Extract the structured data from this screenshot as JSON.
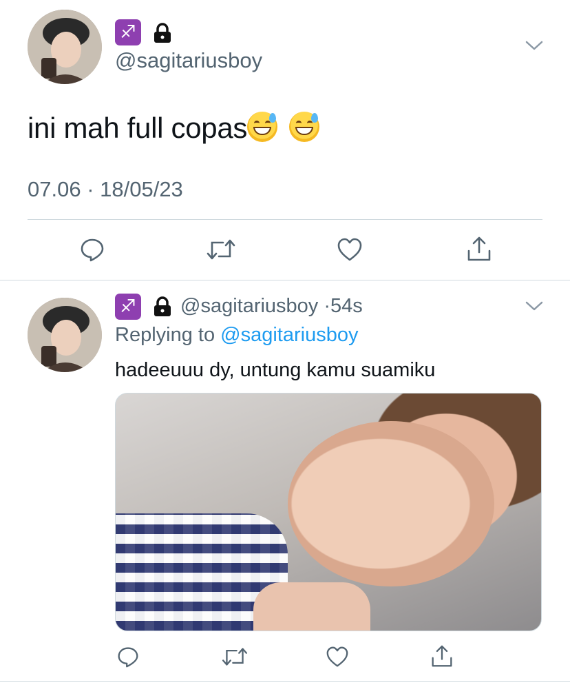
{
  "tweet_main": {
    "zodiac_symbol": "♐",
    "handle": "@sagitariusboy",
    "text": "ini mah full copas",
    "emoji": [
      "grinning-sweat-emoji",
      "grinning-sweat-emoji"
    ],
    "timestamp": "07.06 · 18/05/23"
  },
  "tweet_reply": {
    "zodiac_symbol": "♐",
    "handle": "@sagitariusboy",
    "separator": "·",
    "age": "54s",
    "replying_prefix": "Replying to",
    "replying_handle": "@sagitariusboy",
    "text": "hadeeuuu dy, untung kamu suamiku"
  },
  "icons": {
    "reply": "reply-icon",
    "retweet": "retweet-icon",
    "like": "heart-icon",
    "share": "share-icon",
    "more": "chevron-down-icon",
    "lock": "lock-icon"
  },
  "colors": {
    "link": "#1d9bf0",
    "secondary_text": "#536471",
    "zodiac_bg": "#8e3fb0",
    "divider": "#cfd9de"
  }
}
